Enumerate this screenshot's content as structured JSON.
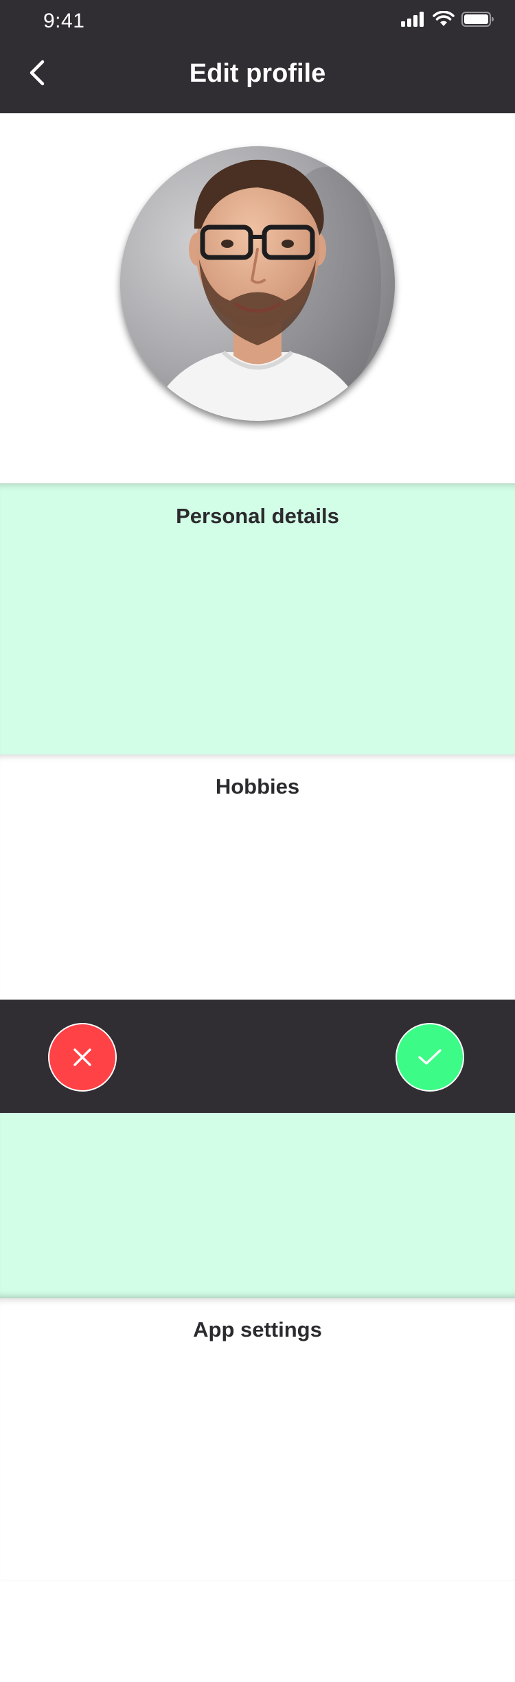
{
  "status_bar": {
    "time": "9:41",
    "icons": [
      "signal-icon",
      "wifi-icon",
      "battery-icon"
    ]
  },
  "nav": {
    "title": "Edit profile",
    "back_icon": "chevron-left-icon"
  },
  "profile": {
    "avatar": "profile-photo"
  },
  "sections": {
    "personal": {
      "title": "Personal details"
    },
    "hobbies": {
      "title": "Hobbies"
    },
    "app_settings": {
      "title": "App settings"
    }
  },
  "actions": {
    "cancel_icon": "close-icon",
    "confirm_icon": "check-icon"
  },
  "colors": {
    "header_bg": "#302d33",
    "section_green": "#d2fde6",
    "cancel_red": "#ff4246",
    "confirm_green": "#3dfb87",
    "title_text": "#2b2a2e"
  }
}
